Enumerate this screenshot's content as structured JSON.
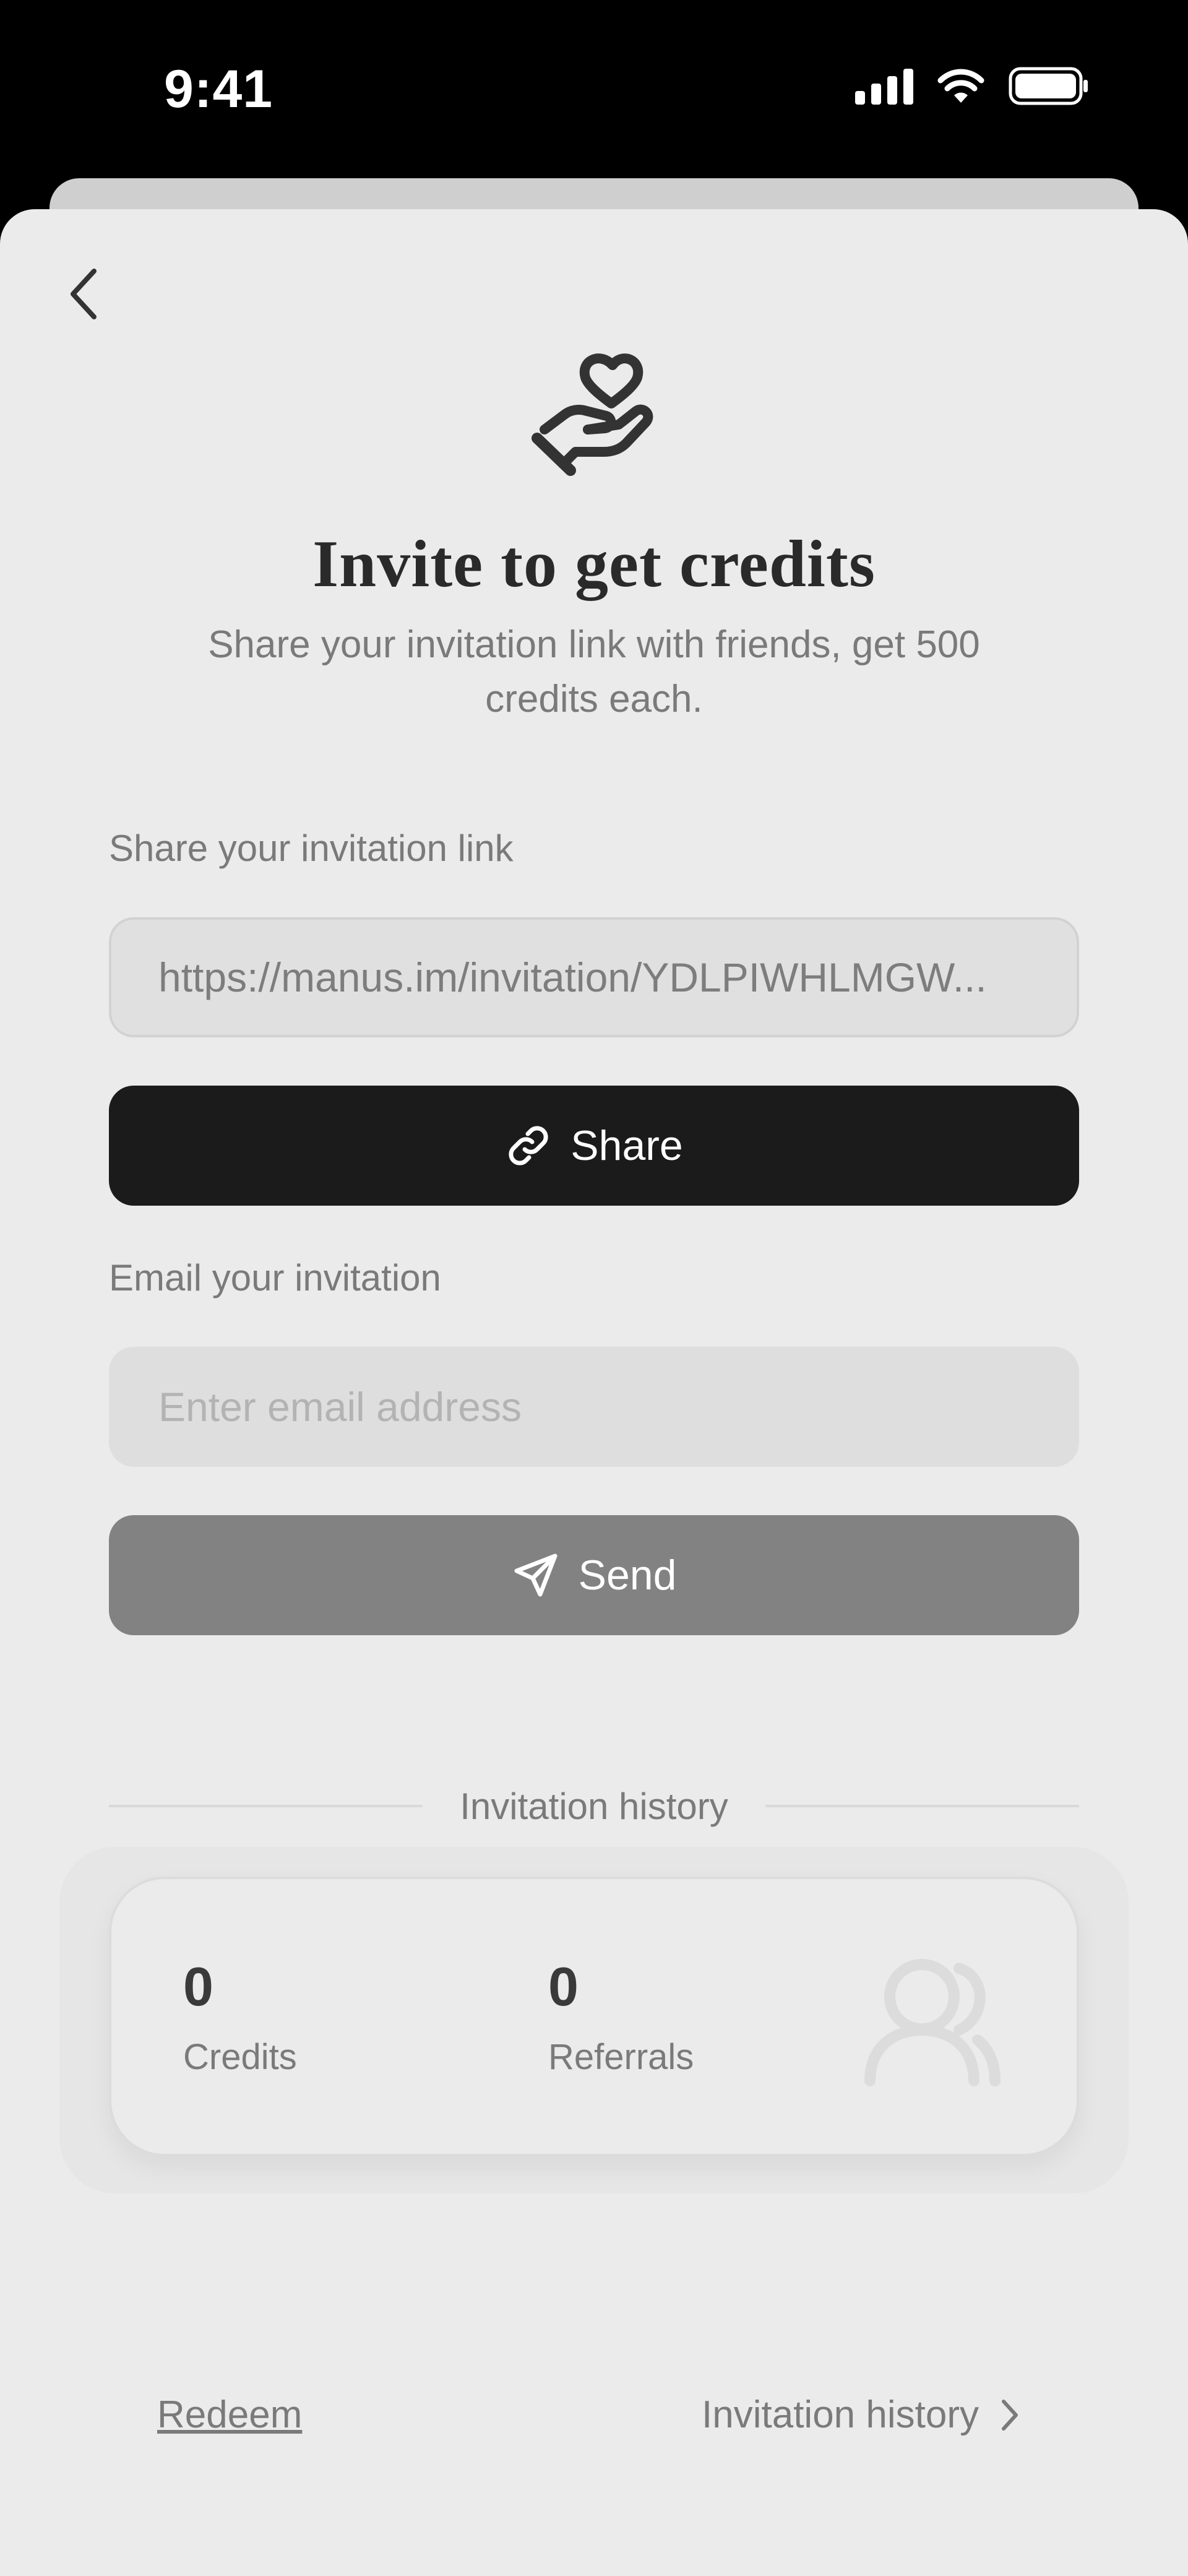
{
  "status_bar": {
    "time": "9:41"
  },
  "header": {
    "title": "Invite to get credits",
    "subtitle": "Share your invitation link with friends, get 500 credits each."
  },
  "share_section": {
    "label": "Share your invitation link",
    "link_value": "https://manus.im/invitation/YDLPIWHLMGW...",
    "share_button_label": "Share"
  },
  "email_section": {
    "label": "Email your invitation",
    "placeholder": "Enter email address",
    "send_button_label": "Send"
  },
  "history": {
    "divider_label": "Invitation history",
    "credits_value": "0",
    "credits_label": "Credits",
    "referrals_value": "0",
    "referrals_label": "Referrals"
  },
  "footer": {
    "redeem_label": "Redeem",
    "history_link_label": "Invitation history"
  },
  "icons": {
    "back": "chevron-left-icon",
    "hero": "hand-heart-icon",
    "share": "link-icon",
    "send": "send-icon",
    "people": "users-icon",
    "history_chevron": "chevron-right-icon"
  },
  "colors": {
    "background": "#ebebeb",
    "primary_button": "#1b1b1b",
    "disabled_button": "#828282",
    "text_primary": "#2a2a2a",
    "text_secondary": "#7a7a7a"
  }
}
